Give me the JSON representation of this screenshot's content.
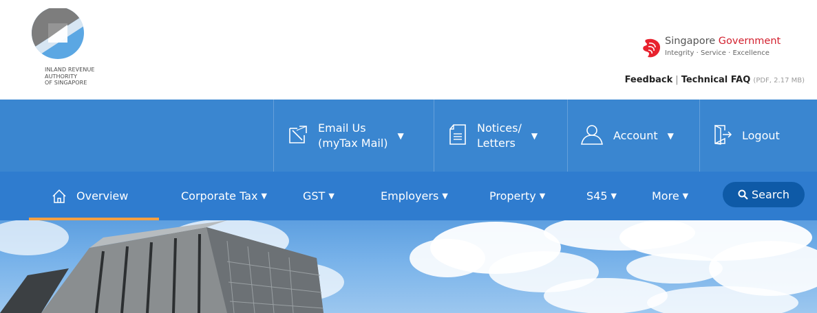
{
  "brand": {
    "logo_lines": [
      "INLAND REVENUE",
      "AUTHORITY",
      "OF SINGAPORE"
    ],
    "gov_title_1": "Singapore ",
    "gov_title_2": "Government",
    "gov_motto": "Integrity · Service · Excellence"
  },
  "util_links": {
    "feedback": "Feedback",
    "separator": "|",
    "faq": "Technical FAQ",
    "faq_note": "(PDF, 2.17 MB)"
  },
  "topbar": {
    "email_line1": "Email Us",
    "email_line2": "(myTax Mail)",
    "notices_line1": "Notices/",
    "notices_line2": "Letters",
    "account": "Account",
    "logout": "Logout",
    "caret": "▼"
  },
  "nav": {
    "overview": "Overview",
    "corporate_tax": "Corporate Tax",
    "gst": "GST",
    "employers": "Employers",
    "property": "Property",
    "s45": "S45",
    "more": "More",
    "caret": "▼",
    "search": "Search"
  },
  "colors": {
    "topbar": "#3a86d0",
    "nav": "#2f7ccf",
    "active_underline": "#f5a042",
    "search_button": "#0e5aa7",
    "gov_red": "#d21f2d"
  },
  "icons": {
    "logo": "iras-logo",
    "lion": "lion-head-icon",
    "email": "compose-mail-icon",
    "notices": "document-icon",
    "account": "user-icon",
    "logout": "exit-door-icon",
    "home": "home-icon",
    "search": "magnifier-icon"
  }
}
